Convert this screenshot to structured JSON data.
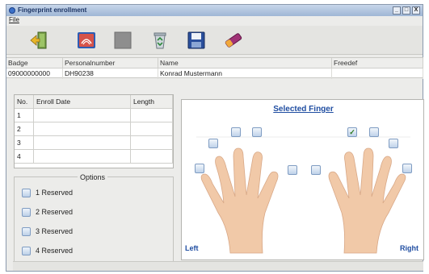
{
  "window": {
    "title": "Fingerprint enrollment",
    "controls": [
      "_",
      "□",
      "X"
    ]
  },
  "menu": {
    "items": [
      "File"
    ]
  },
  "toolbar": {
    "buttons": [
      {
        "icon": "exit-door-icon"
      },
      {
        "icon": "fingerprint-scan-icon"
      },
      {
        "icon": "stop-icon"
      },
      {
        "icon": "recycle-delete-icon"
      },
      {
        "icon": "save-disk-icon"
      },
      {
        "icon": "eraser-icon"
      }
    ]
  },
  "badge_grid": {
    "headers": {
      "badge": "Badge",
      "personalnumber": "Personalnumber",
      "name": "Name",
      "freedef": "Freedef"
    },
    "row": {
      "badge": "09000000000",
      "personalnumber": "DH90238",
      "name": "Konrad Mustermann",
      "freedef": ""
    }
  },
  "enroll_table": {
    "headers": {
      "no": "No.",
      "date": "Enroll Date",
      "length": "Length"
    },
    "rows": [
      {
        "no": "1",
        "date": "",
        "length": ""
      },
      {
        "no": "2",
        "date": "",
        "length": ""
      },
      {
        "no": "3",
        "date": "",
        "length": ""
      },
      {
        "no": "4",
        "date": "",
        "length": ""
      }
    ]
  },
  "options": {
    "legend": "Options",
    "items": [
      {
        "label": "1 Reserved",
        "checked": false
      },
      {
        "label": "2 Reserved",
        "checked": false
      },
      {
        "label": "3 Reserved",
        "checked": false
      },
      {
        "label": "4 Reserved",
        "checked": false
      }
    ]
  },
  "finger_panel": {
    "heading": "Selected Finger",
    "left_label": "Left",
    "right_label": "Right",
    "left_hand": [
      {
        "finger": "pinky",
        "checked": false
      },
      {
        "finger": "ring",
        "checked": false
      },
      {
        "finger": "middle",
        "checked": false
      },
      {
        "finger": "index",
        "checked": false
      },
      {
        "finger": "thumb",
        "checked": false
      }
    ],
    "right_hand": [
      {
        "finger": "thumb",
        "checked": false
      },
      {
        "finger": "index",
        "checked": true
      },
      {
        "finger": "middle",
        "checked": false
      },
      {
        "finger": "ring",
        "checked": false
      },
      {
        "finger": "pinky",
        "checked": false
      }
    ],
    "check_glyph": "✓"
  },
  "colors": {
    "accent": "#1f4da1",
    "skin": "#f1c9a8",
    "window_bg": "#ececea",
    "titlebar": "#9fb6d5"
  }
}
